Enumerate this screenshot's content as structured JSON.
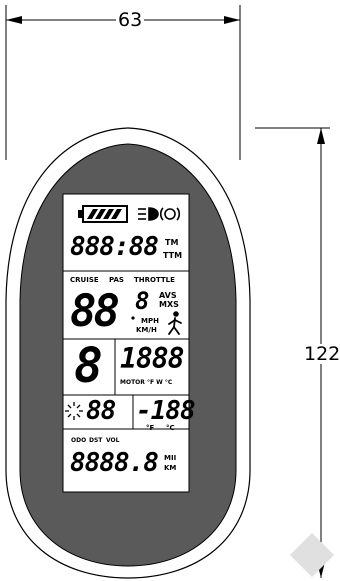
{
  "dimensions": {
    "width": "63",
    "height": "122"
  },
  "display": {
    "time": "888:88",
    "time_units": [
      "TM",
      "TTM"
    ],
    "mode_labels": {
      "cruise": "CRUISE",
      "pas": "PAS",
      "throttle": "THROTTLE"
    },
    "speed": "88",
    "speed_decimal": "8",
    "avg_max": [
      "AVS",
      "MXS"
    ],
    "speed_units": [
      "MPH",
      "KM/H"
    ],
    "level": "8",
    "motor_value": "1888",
    "motor_label": "MOTOR  °F  W  °C",
    "temp_left": "88",
    "temp_right": "-188",
    "temp_units": [
      "°F",
      "°C"
    ],
    "dist_labels": [
      "ODO",
      "DST",
      "VOL"
    ],
    "distance": "8888.8",
    "dist_units": [
      "MII",
      "KM"
    ]
  },
  "icons": [
    "battery-icon",
    "headlight-icon",
    "brake-icon",
    "sun-icon",
    "walk-assist-icon"
  ],
  "colors": {
    "housing_outer": "#ffffff",
    "housing_dark": "#5a5a5a",
    "screen": "#ffffff",
    "outline": "#000000"
  }
}
